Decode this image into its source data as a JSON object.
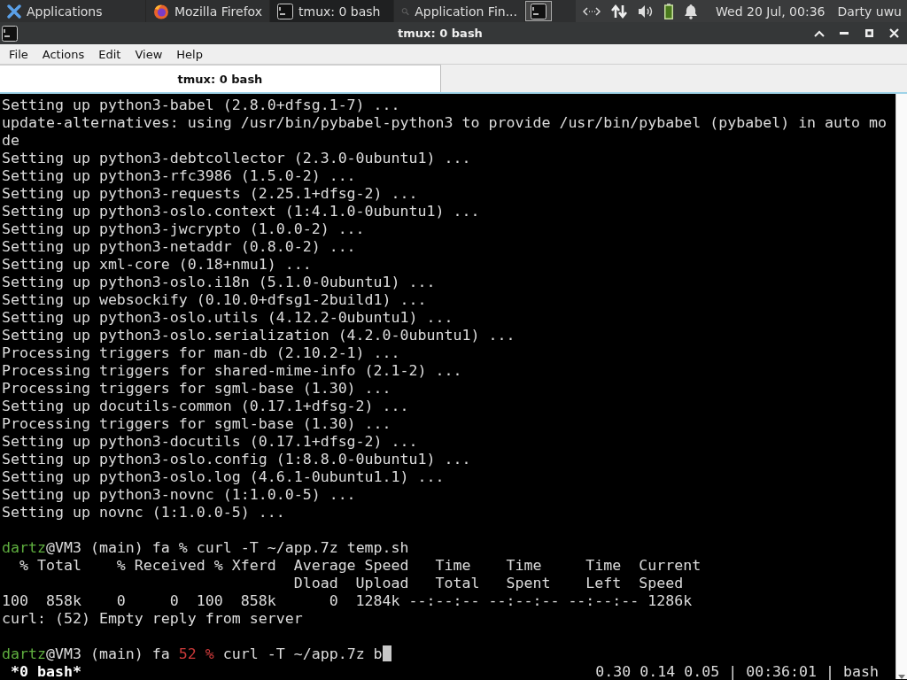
{
  "taskbar": {
    "items": [
      {
        "kind": "menu",
        "label": "Applications",
        "selected": false
      },
      {
        "kind": "browser",
        "label": "Mozilla Firefox",
        "selected": false
      },
      {
        "kind": "terminal",
        "label": "tmux: 0 bash",
        "selected": true
      },
      {
        "kind": "finder",
        "label": "Application Fin...",
        "selected": false
      },
      {
        "kind": "workspace",
        "selected": true
      }
    ],
    "clock": "Wed 20 Jul, 00:36",
    "user": "Darty uwu"
  },
  "window": {
    "title": "tmux: 0 bash"
  },
  "menu": [
    "File",
    "Actions",
    "Edit",
    "View",
    "Help"
  ],
  "tabs": [
    {
      "label": "tmux: 0 bash",
      "selected": true
    }
  ],
  "terminal": {
    "lines": [
      {
        "kind": "output",
        "text": "Setting up python3-babel (2.8.0+dfsg.1-7) ..."
      },
      {
        "kind": "output",
        "text": "update-alternatives: using /usr/bin/pybabel-python3 to provide /usr/bin/pybabel (pybabel) in auto mo"
      },
      {
        "kind": "output",
        "text": "de"
      },
      {
        "kind": "output",
        "text": "Setting up python3-debtcollector (2.3.0-0ubuntu1) ..."
      },
      {
        "kind": "output",
        "text": "Setting up python3-rfc3986 (1.5.0-2) ..."
      },
      {
        "kind": "output",
        "text": "Setting up python3-requests (2.25.1+dfsg-2) ..."
      },
      {
        "kind": "output",
        "text": "Setting up python3-oslo.context (1:4.1.0-0ubuntu1) ..."
      },
      {
        "kind": "output",
        "text": "Setting up python3-jwcrypto (1.0.0-2) ..."
      },
      {
        "kind": "output",
        "text": "Setting up python3-netaddr (0.8.0-2) ..."
      },
      {
        "kind": "output",
        "text": "Setting up xml-core (0.18+nmu1) ..."
      },
      {
        "kind": "output",
        "text": "Setting up python3-oslo.i18n (5.1.0-0ubuntu1) ..."
      },
      {
        "kind": "output",
        "text": "Setting up websockify (0.10.0+dfsg1-2build1) ..."
      },
      {
        "kind": "output",
        "text": "Setting up python3-oslo.utils (4.12.2-0ubuntu1) ..."
      },
      {
        "kind": "output",
        "text": "Setting up python3-oslo.serialization (4.2.0-0ubuntu1) ..."
      },
      {
        "kind": "output",
        "text": "Processing triggers for man-db (2.10.2-1) ..."
      },
      {
        "kind": "output",
        "text": "Processing triggers for shared-mime-info (2.1-2) ..."
      },
      {
        "kind": "output",
        "text": "Processing triggers for sgml-base (1.30) ..."
      },
      {
        "kind": "output",
        "text": "Setting up docutils-common (0.17.1+dfsg-2) ..."
      },
      {
        "kind": "output",
        "text": "Processing triggers for sgml-base (1.30) ..."
      },
      {
        "kind": "output",
        "text": "Setting up python3-docutils (0.17.1+dfsg-2) ..."
      },
      {
        "kind": "output",
        "text": "Setting up python3-oslo.config (1:8.8.0-0ubuntu1) ..."
      },
      {
        "kind": "output",
        "text": "Setting up python3-oslo.log (4.6.1-0ubuntu1.1) ..."
      },
      {
        "kind": "output",
        "text": "Setting up python3-novnc (1:1.0.0-5) ..."
      },
      {
        "kind": "output",
        "text": "Setting up novnc (1:1.0.0-5) ..."
      },
      {
        "kind": "blank"
      },
      {
        "kind": "prompt",
        "user": "dartz",
        "host": "@VM3 (main) fa",
        "status": "%",
        "error": false,
        "command": "curl -T ~/app.7z temp.sh",
        "cursor": false
      },
      {
        "kind": "output",
        "text": "  % Total    % Received % Xferd  Average Speed   Time    Time     Time  Current"
      },
      {
        "kind": "output",
        "text": "                                 Dload  Upload   Total   Spent    Left  Speed"
      },
      {
        "kind": "output",
        "text": "100  858k    0     0  100  858k      0  1284k --:--:-- --:--:-- --:--:-- 1286k"
      },
      {
        "kind": "output",
        "text": "curl: (52) Empty reply from server"
      },
      {
        "kind": "blank"
      },
      {
        "kind": "prompt",
        "user": "dartz",
        "host": "@VM3 (main) fa",
        "status": "52 %",
        "error": true,
        "command": "curl -T ~/app.7z b",
        "cursor": true
      }
    ],
    "status_left": "*0 bash*",
    "status_right": "0.30 0.14 0.05 | 00:36:01 | bash"
  }
}
